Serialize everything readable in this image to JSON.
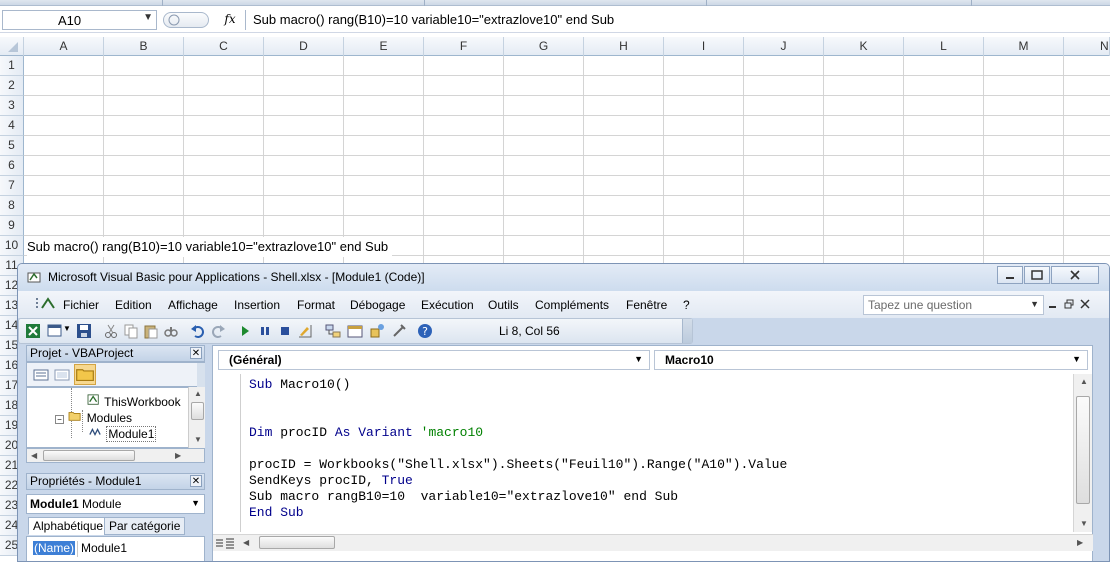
{
  "formula_bar": {
    "name_box": "A10",
    "fx_label": "fx",
    "formula": "Sub macro() rang(B10)=10  variable10=\"extrazlove10\" end Sub"
  },
  "sheet": {
    "columns": [
      "A",
      "B",
      "C",
      "D",
      "E",
      "F",
      "G",
      "H",
      "I",
      "J",
      "K",
      "L",
      "M",
      "N"
    ],
    "rows": [
      "1",
      "2",
      "3",
      "4",
      "5",
      "6",
      "7",
      "8",
      "9",
      "10",
      "11",
      "12",
      "13",
      "14",
      "15",
      "16",
      "17",
      "18",
      "19",
      "20",
      "21",
      "22",
      "23",
      "24",
      "25"
    ],
    "cell_a10": "Sub macro() rang(B10)=10  variable10=\"extrazlove10\" end Sub"
  },
  "vbe": {
    "title": "Microsoft Visual Basic pour Applications - Shell.xlsx - [Module1 (Code)]",
    "menu": [
      "Fichier",
      "Edition",
      "Affichage",
      "Insertion",
      "Format",
      "Débogage",
      "Exécution",
      "Outils",
      "Compléments",
      "Fenêtre",
      "?"
    ],
    "help_placeholder": "Tapez une question",
    "position": "Li 8, Col 56",
    "project_pane": {
      "title": "Projet - VBAProject",
      "nodes": [
        "ThisWorkbook",
        "Modules",
        "Module1"
      ]
    },
    "properties_pane": {
      "title": "Propriétés - Module1",
      "object_bold": "Module1",
      "object_type": "Module",
      "tab_alpha": "Alphabétique",
      "tab_category": "Par catégorie",
      "prop_key": "(Name)",
      "prop_value": "Module1"
    },
    "code": {
      "object_combo": "(Général)",
      "proc_combo": "Macro10",
      "lines": {
        "l1_kw": "Sub",
        "l1_rest": " Macro10()",
        "l4_kw1": "Dim",
        "l4_mid": " procID ",
        "l4_kw2": "As",
        "l4_rest": " Variant ",
        "l4_comment": "'macro10",
        "l6": "procID = Workbooks(\"Shell.xlsx\").Sheets(\"Feuil10\").Range(\"A10\").Value",
        "l7_start": "SendKeys procID, ",
        "l7_kw": "True",
        "l8": "Sub macro rangB10=10  variable10=\"extrazlove10\" end Sub",
        "l9_kw": "End Sub"
      }
    }
  }
}
